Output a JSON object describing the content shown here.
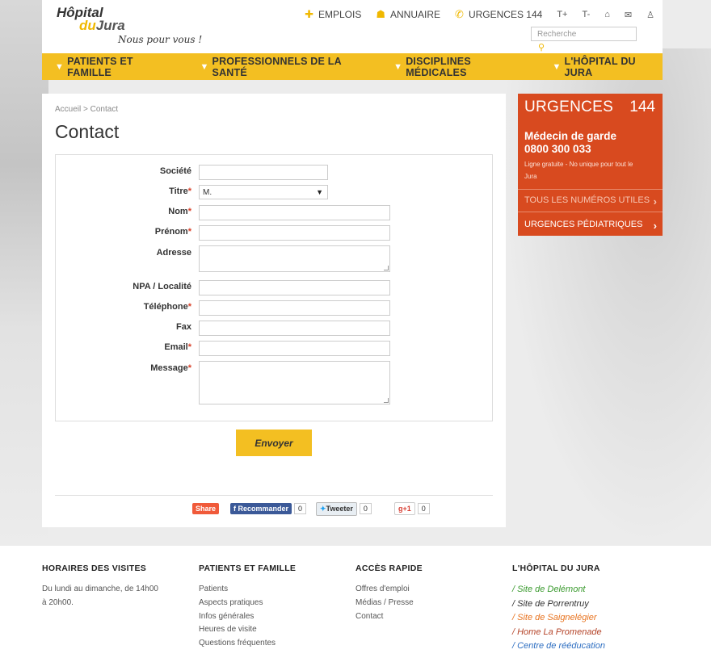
{
  "header": {
    "logo_line1": "Hôpital",
    "logo_line2a": "du",
    "logo_line2b": "Jura",
    "tagline": "Nous pour vous !",
    "links": [
      {
        "label": "EMPLOIS",
        "icon": "puzzle-icon"
      },
      {
        "label": "ANNUAIRE",
        "icon": "people-icon"
      },
      {
        "label": "URGENCES 144",
        "icon": "phone-icon"
      }
    ],
    "font_increase": "T+",
    "font_decrease": "T-",
    "home_glyph": "⌂",
    "mail_glyph": "✉",
    "person_glyph": "♙",
    "search_placeholder": "Recherche"
  },
  "nav": [
    {
      "label": "PATIENTS ET FAMILLE"
    },
    {
      "label": "PROFESSIONNELS DE LA SANTÉ"
    },
    {
      "label": "DISCIPLINES MÉDICALES"
    },
    {
      "label": "L'HÔPITAL DU JURA"
    }
  ],
  "page": {
    "breadcrumb": "Accueil > Contact",
    "title": "Contact"
  },
  "form": {
    "societe": "Société",
    "titre": "Titre",
    "titre_value": "M.",
    "nom": "Nom",
    "prenom": "Prénom",
    "adresse": "Adresse",
    "npa": "NPA / Localité",
    "telephone": "Téléphone",
    "fax": "Fax",
    "email": "Email",
    "message": "Message",
    "required_mark": "*",
    "submit": "Envoyer"
  },
  "social": {
    "share": "Share",
    "recommander": "Recommander",
    "recommander_count": "0",
    "tweeter": "Tweeter",
    "tweeter_count": "0",
    "gplus": "+1",
    "gplus_count": "0"
  },
  "urgences": {
    "title": "URGENCES",
    "number": "144",
    "medecin_title": "Médecin de garde",
    "medecin_phone": "0800 300 033",
    "note": "Ligne gratuite - No unique pour tout le Jura",
    "link1": "TOUS LES NUMÉROS UTILES",
    "link2": "URGENCES PÉDIATRIQUES",
    "color": "#d84a1f"
  },
  "footer": {
    "col1": {
      "title": "HORAIRES DES VISITES",
      "text": "Du lundi au dimanche, de 14h00 à 20h00."
    },
    "col2": {
      "title": "PATIENTS ET FAMILLE",
      "links": [
        "Patients",
        "Aspects pratiques",
        "Infos générales",
        "Heures de visite",
        "Questions fréquentes"
      ]
    },
    "col3": {
      "title": "ACCÈS RAPIDE",
      "links": [
        "Offres d'emploi",
        "Médias / Presse",
        "Contact"
      ]
    },
    "col4": {
      "title": "L'HÔPITAL DU JURA",
      "sites": [
        {
          "label": "/ Site de Delémont",
          "color": "#3a9a2e"
        },
        {
          "label": "/ Site de Porrentruy",
          "color": "#333333"
        },
        {
          "label": "/ Site de Saignelégier",
          "color": "#e8731f"
        },
        {
          "label": "/ Home La Promenade",
          "color": "#b5452a"
        },
        {
          "label": "/ Centre de rééducation",
          "color": "#2f6fc2"
        }
      ]
    }
  },
  "colors": {
    "accent": "#f3bf22"
  }
}
